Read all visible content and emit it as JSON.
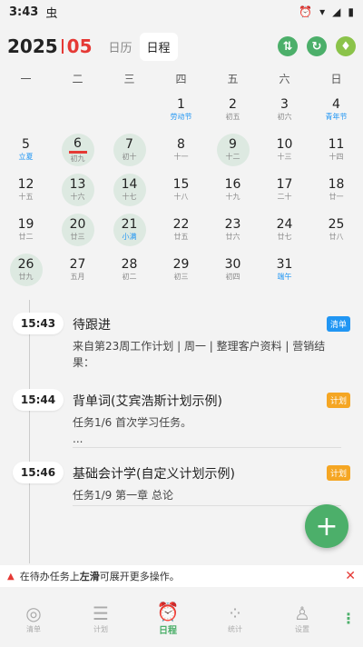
{
  "status": {
    "time": "3:43",
    "bug": "虫",
    "icons": [
      "alarm-icon",
      "wifi-icon",
      "signal-icon",
      "battery-icon"
    ]
  },
  "header": {
    "year": "2025",
    "month": "05",
    "tabs": [
      {
        "label": "日历",
        "active": false
      },
      {
        "label": "日程",
        "active": true
      }
    ],
    "actions": [
      "sort-icon",
      "refresh-icon",
      "bulb-icon"
    ]
  },
  "calendar": {
    "weekdays": [
      "一",
      "二",
      "三",
      "四",
      "五",
      "六",
      "日"
    ],
    "weeks": [
      [
        null,
        null,
        null,
        {
          "day": "1",
          "sub": "劳动节",
          "holiday": true
        },
        {
          "day": "2",
          "sub": "初五"
        },
        {
          "day": "3",
          "sub": "初六"
        },
        {
          "day": "4",
          "sub": "青年节",
          "holiday": true
        }
      ],
      [
        {
          "day": "5",
          "sub": "立夏",
          "holiday": true
        },
        {
          "day": "6",
          "sub": "初九",
          "marked": true,
          "today": true
        },
        {
          "day": "7",
          "sub": "初十",
          "marked": true
        },
        {
          "day": "8",
          "sub": "十一"
        },
        {
          "day": "9",
          "sub": "十二",
          "marked": true
        },
        {
          "day": "10",
          "sub": "十三"
        },
        {
          "day": "11",
          "sub": "十四"
        }
      ],
      [
        {
          "day": "12",
          "sub": "十五"
        },
        {
          "day": "13",
          "sub": "十六",
          "marked": true
        },
        {
          "day": "14",
          "sub": "十七",
          "marked": true
        },
        {
          "day": "15",
          "sub": "十八"
        },
        {
          "day": "16",
          "sub": "十九"
        },
        {
          "day": "17",
          "sub": "二十"
        },
        {
          "day": "18",
          "sub": "廿一"
        }
      ],
      [
        {
          "day": "19",
          "sub": "廿二"
        },
        {
          "day": "20",
          "sub": "廿三",
          "marked": true
        },
        {
          "day": "21",
          "sub": "小满",
          "marked": true,
          "holiday": true
        },
        {
          "day": "22",
          "sub": "廿五"
        },
        {
          "day": "23",
          "sub": "廿六"
        },
        {
          "day": "24",
          "sub": "廿七"
        },
        {
          "day": "25",
          "sub": "廿八"
        }
      ],
      [
        {
          "day": "26",
          "sub": "廿九",
          "marked": true
        },
        {
          "day": "27",
          "sub": "五月"
        },
        {
          "day": "28",
          "sub": "初二"
        },
        {
          "day": "29",
          "sub": "初三"
        },
        {
          "day": "30",
          "sub": "初四"
        },
        {
          "day": "31",
          "sub": "端午",
          "holiday": true
        },
        null
      ]
    ]
  },
  "tasks": [
    {
      "time": "15:43",
      "title": "待跟进",
      "tag": "清单",
      "tag_color": "#2196f3",
      "desc_lines": [
        "来自第23周工作计划 | 周一 | 整理客户资料 | 营销结",
        "果："
      ]
    },
    {
      "time": "15:44",
      "title": "背单词(艾宾浩斯计划示例)",
      "tag": "计划",
      "tag_color": "#f5a623",
      "desc_lines": [
        "任务1/6 首次学习任务。",
        "..."
      ]
    },
    {
      "time": "15:46",
      "title": "基础会计学(自定义计划示例)",
      "tag": "计划",
      "tag_color": "#f5a623",
      "desc_lines": [
        "任务1/9 第一章 总论"
      ]
    }
  ],
  "fab": {
    "label": "+"
  },
  "tip": {
    "before": "在待办任务上",
    "strong": "左滑",
    "after": "可展开更多操作。",
    "close": "✕"
  },
  "bottom_nav": [
    {
      "label": "清单",
      "icon": "target-icon",
      "active": false
    },
    {
      "label": "计划",
      "icon": "list-icon",
      "active": false
    },
    {
      "label": "日程",
      "icon": "alarm-clock-icon",
      "active": true
    },
    {
      "label": "统计",
      "icon": "chart-icon",
      "active": false
    },
    {
      "label": "设置",
      "icon": "person-icon",
      "active": false
    }
  ],
  "more": "⋮",
  "colors": {
    "accent": "#4caf6a",
    "red": "#e53935",
    "blue": "#2196f3",
    "orange": "#f5a623"
  }
}
